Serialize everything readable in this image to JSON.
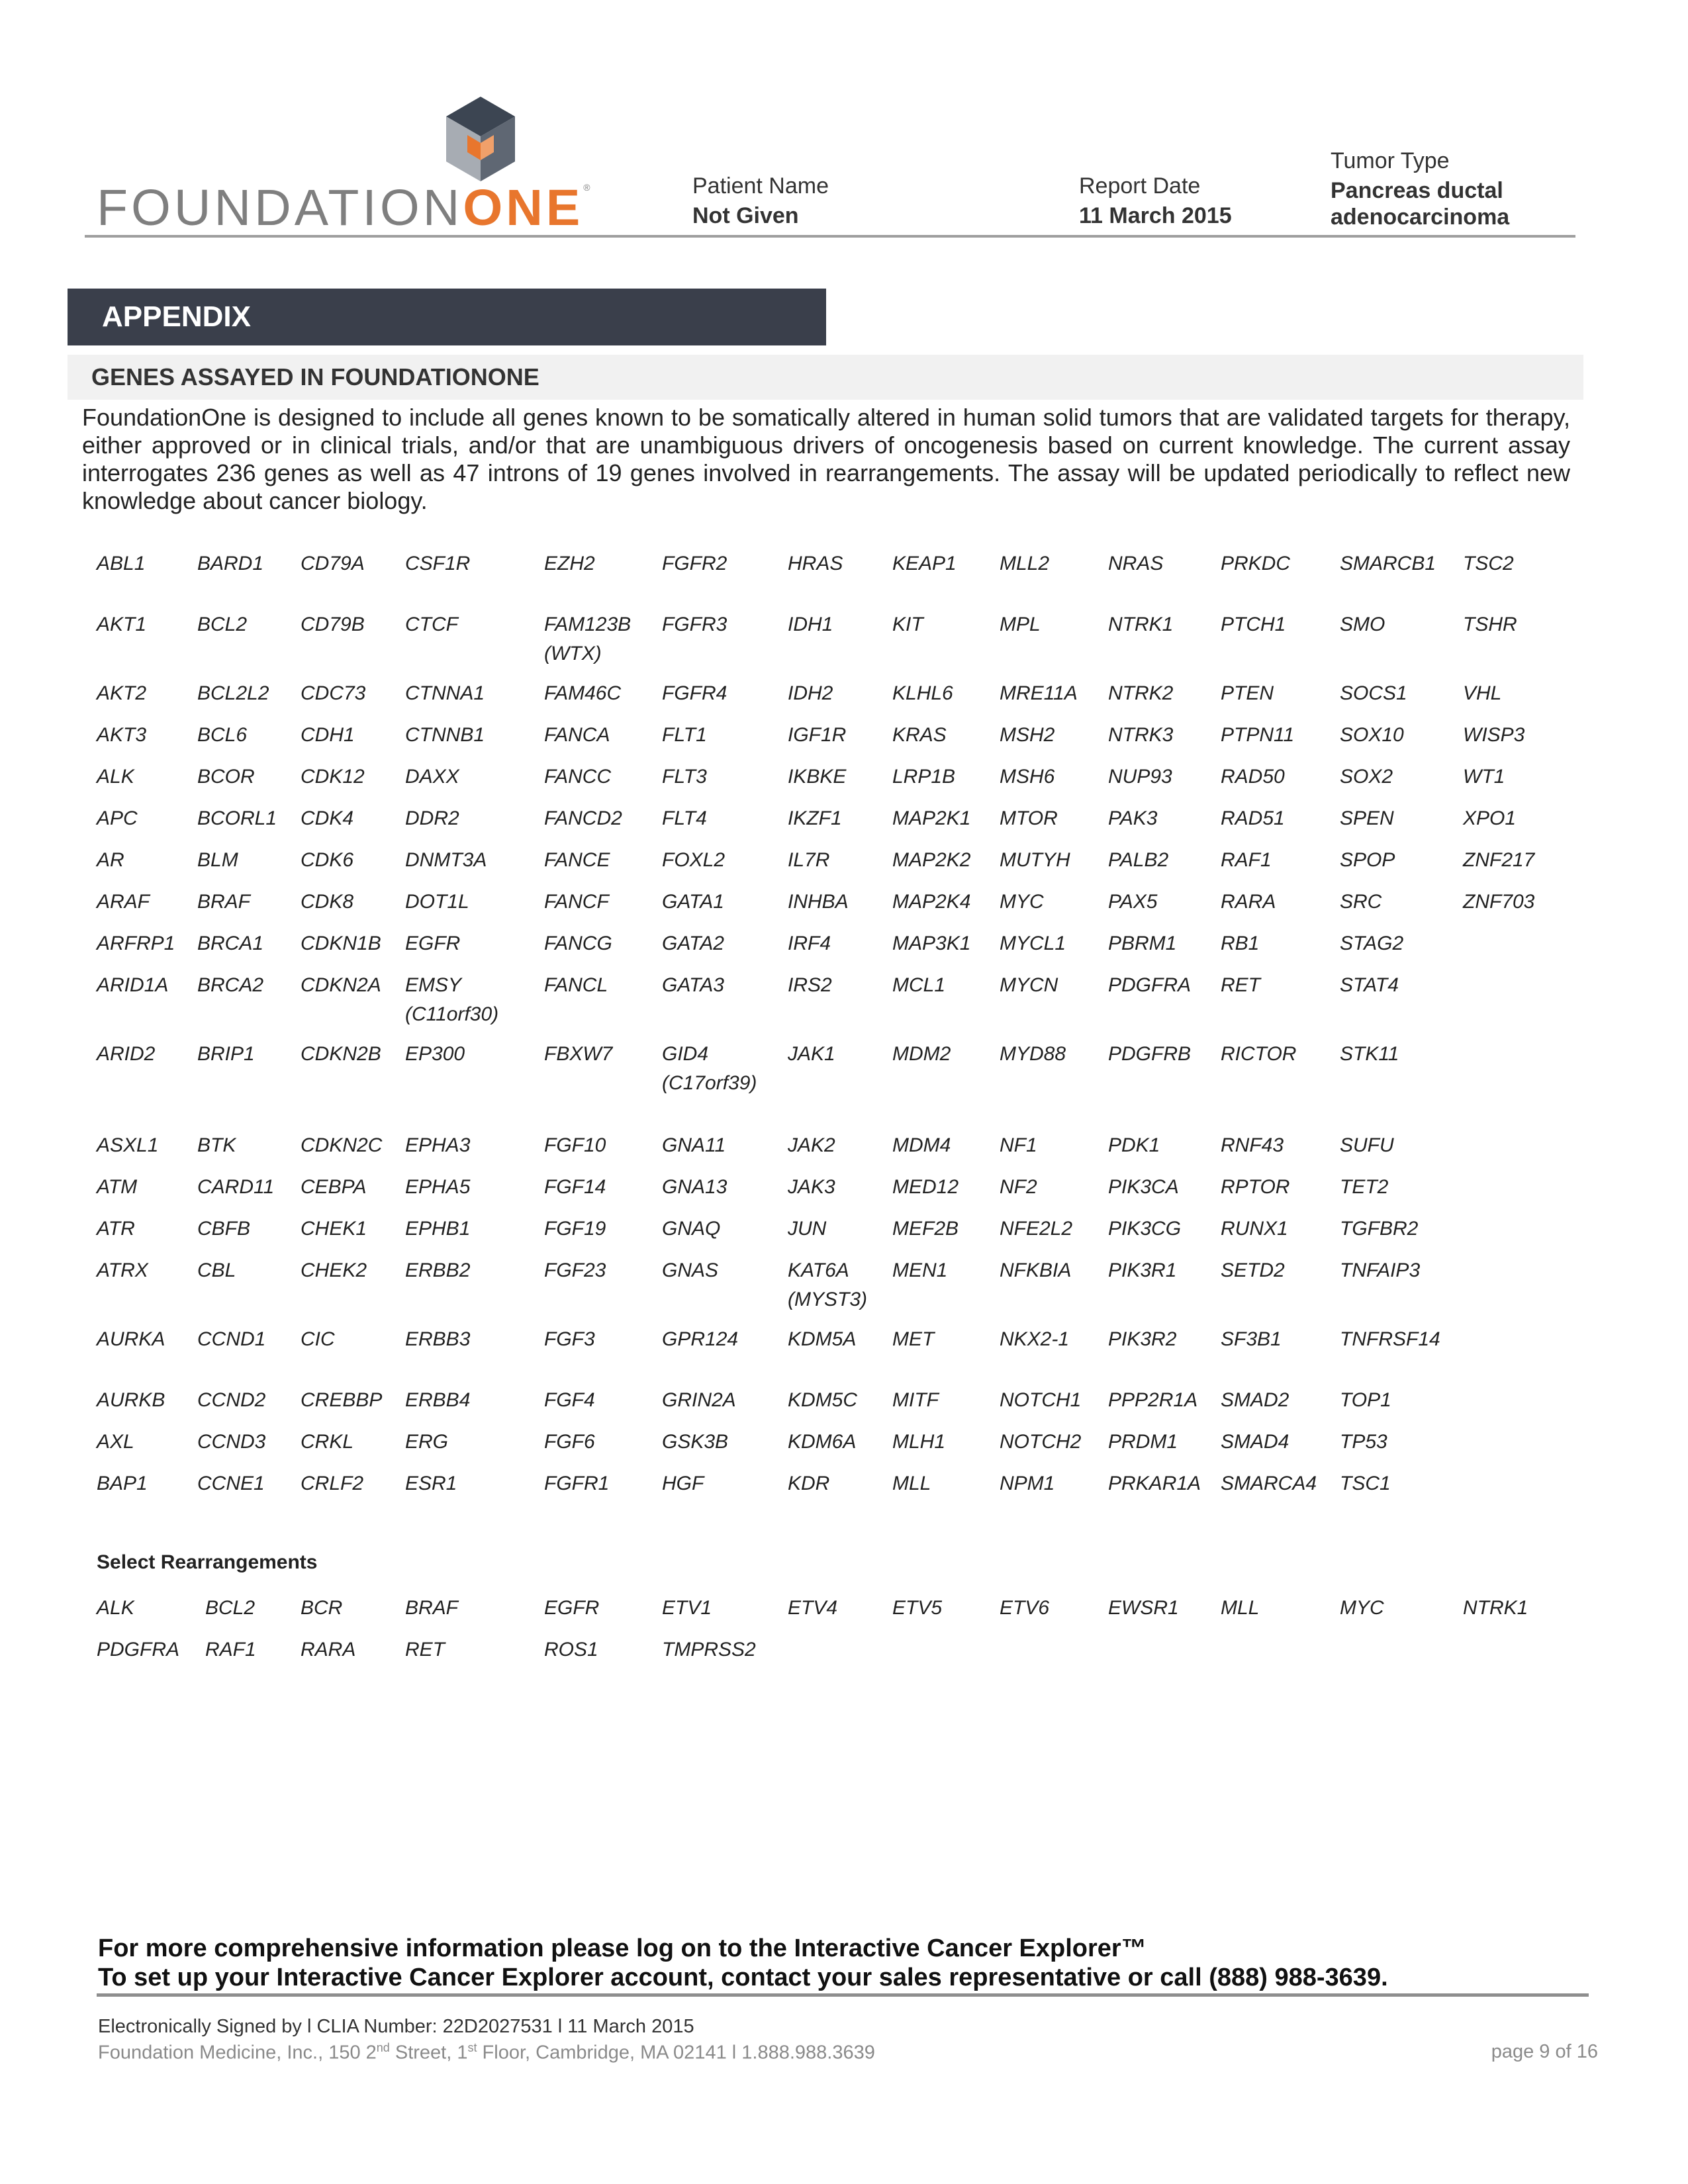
{
  "header": {
    "logo_text_light": "FOUNDATION",
    "logo_text_bold": "ONE",
    "logo_mark": "®",
    "patient_name_label": "Patient Name",
    "patient_name_value": "Not Given",
    "report_date_label": "Report Date",
    "report_date_value": "11 March 2015",
    "tumor_type_label": "Tumor Type",
    "tumor_type_value_line1": "Pancreas ductal",
    "tumor_type_value_line2": "adenocarcinoma"
  },
  "appendix": {
    "title": "APPENDIX",
    "section_title": "GENES ASSAYED IN FOUNDATIONONE",
    "intro": "FoundationOne is designed to include all genes known to be somatically altered in human solid tumors that are validated targets for therapy, either approved or in clinical trials, and/or that are unambiguous drivers of oncogenesis based on current knowledge. The current assay interrogates 236 genes as well as 47 introns of 19 genes involved in rearrangements. The assay will be updated periodically to reflect new knowledge about cancer biology."
  },
  "genes": [
    [
      "ABL1",
      "BARD1",
      "CD79A",
      "CSF1R",
      "EZH2",
      "FGFR2",
      "HRAS",
      "KEAP1",
      "MLL2",
      "NRAS",
      "PRKDC",
      "SMARCB1",
      "TSC2"
    ],
    [
      "AKT1",
      "BCL2",
      "CD79B",
      "CTCF",
      "FAM123B\n(WTX)",
      "FGFR3",
      "IDH1",
      "KIT",
      "MPL",
      "NTRK1",
      "PTCH1",
      "SMO",
      "TSHR"
    ],
    [
      "AKT2",
      "BCL2L2",
      "CDC73",
      "CTNNA1",
      "FAM46C",
      "FGFR4",
      "IDH2",
      "KLHL6",
      "MRE11A",
      "NTRK2",
      "PTEN",
      "SOCS1",
      "VHL"
    ],
    [
      "AKT3",
      "BCL6",
      "CDH1",
      "CTNNB1",
      "FANCA",
      "FLT1",
      "IGF1R",
      "KRAS",
      "MSH2",
      "NTRK3",
      "PTPN11",
      "SOX10",
      "WISP3"
    ],
    [
      "ALK",
      "BCOR",
      "CDK12",
      "DAXX",
      "FANCC",
      "FLT3",
      "IKBKE",
      "LRP1B",
      "MSH6",
      "NUP93",
      "RAD50",
      "SOX2",
      "WT1"
    ],
    [
      "APC",
      "BCORL1",
      "CDK4",
      "DDR2",
      "FANCD2",
      "FLT4",
      "IKZF1",
      "MAP2K1",
      "MTOR",
      "PAK3",
      "RAD51",
      "SPEN",
      "XPO1"
    ],
    [
      "AR",
      "BLM",
      "CDK6",
      "DNMT3A",
      "FANCE",
      "FOXL2",
      "IL7R",
      "MAP2K2",
      "MUTYH",
      "PALB2",
      "RAF1",
      "SPOP",
      "ZNF217"
    ],
    [
      "ARAF",
      "BRAF",
      "CDK8",
      "DOT1L",
      "FANCF",
      "GATA1",
      "INHBA",
      "MAP2K4",
      "MYC",
      "PAX5",
      "RARA",
      "SRC",
      "ZNF703"
    ],
    [
      "ARFRP1",
      "BRCA1",
      "CDKN1B",
      "EGFR",
      "FANCG",
      "GATA2",
      "IRF4",
      "MAP3K1",
      "MYCL1",
      "PBRM1",
      "RB1",
      "STAG2",
      ""
    ],
    [
      "ARID1A",
      "BRCA2",
      "CDKN2A",
      "EMSY\n(C11orf30)",
      "FANCL",
      "GATA3",
      "IRS2",
      "MCL1",
      "MYCN",
      "PDGFRA",
      "RET",
      "STAT4",
      ""
    ],
    [
      "ARID2",
      "BRIP1",
      "CDKN2B",
      "EP300",
      "FBXW7",
      "GID4\n(C17orf39)",
      "JAK1",
      "MDM2",
      "MYD88",
      "PDGFRB",
      "RICTOR",
      "STK11",
      ""
    ],
    [
      "ASXL1",
      "BTK",
      "CDKN2C",
      "EPHA3",
      "FGF10",
      "GNA11",
      "JAK2",
      "MDM4",
      "NF1",
      "PDK1",
      "RNF43",
      "SUFU",
      ""
    ],
    [
      "ATM",
      "CARD11",
      "CEBPA",
      "EPHA5",
      "FGF14",
      "GNA13",
      "JAK3",
      "MED12",
      "NF2",
      "PIK3CA",
      "RPTOR",
      "TET2",
      ""
    ],
    [
      "ATR",
      "CBFB",
      "CHEK1",
      "EPHB1",
      "FGF19",
      "GNAQ",
      "JUN",
      "MEF2B",
      "NFE2L2",
      "PIK3CG",
      "RUNX1",
      "TGFBR2",
      ""
    ],
    [
      "ATRX",
      "CBL",
      "CHEK2",
      "ERBB2",
      "FGF23",
      "GNAS",
      "KAT6A\n(MYST3)",
      "MEN1",
      "NFKBIA",
      "PIK3R1",
      "SETD2",
      "TNFAIP3",
      ""
    ],
    [
      "AURKA",
      "CCND1",
      "CIC",
      "ERBB3",
      "FGF3",
      "GPR124",
      "KDM5A",
      "MET",
      "NKX2-1",
      "PIK3R2",
      "SF3B1",
      "TNFRSF14",
      ""
    ],
    [
      "AURKB",
      "CCND2",
      "CREBBP",
      "ERBB4",
      "FGF4",
      "GRIN2A",
      "KDM5C",
      "MITF",
      "NOTCH1",
      "PPP2R1A",
      "SMAD2",
      "TOP1",
      ""
    ],
    [
      "AXL",
      "CCND3",
      "CRKL",
      "ERG",
      "FGF6",
      "GSK3B",
      "KDM6A",
      "MLH1",
      "NOTCH2",
      "PRDM1",
      "SMAD4",
      "TP53",
      ""
    ],
    [
      "BAP1",
      "CCNE1",
      "CRLF2",
      "ESR1",
      "FGFR1",
      "HGF",
      "KDR",
      "MLL",
      "NPM1",
      "PRKAR1A",
      "SMARCA4",
      "TSC1",
      ""
    ]
  ],
  "rearrangements": {
    "title": "Select Rearrangements",
    "rows": [
      [
        "ALK",
        "BCL2",
        "BCR",
        "BRAF",
        "EGFR",
        "ETV1",
        "ETV4",
        "ETV5",
        "ETV6",
        "EWSR1",
        "MLL",
        "MYC",
        "NTRK1"
      ],
      [
        "PDGFRA",
        "RAF1",
        "RARA",
        "RET",
        "ROS1",
        "TMPRSS2",
        "",
        "",
        "",
        "",
        "",
        "",
        ""
      ]
    ]
  },
  "footer": {
    "line1": "For more comprehensive information please log on to the Interactive Cancer Explorer™",
    "line2": "To set up your Interactive Cancer Explorer account, contact your sales representative or call  (888) 988-3639.",
    "signed": "Electronically Signed by  l CLIA Number: 22D2027531 l 11 March 2015",
    "address_a": "Foundation Medicine, Inc., 150 2",
    "address_sup1": "nd",
    "address_b": " Street, 1",
    "address_sup2": "st",
    "address_c": " Floor, Cambridge, MA 02141 l 1.888.988.3639",
    "page": "page 9 of 16"
  },
  "colors": {
    "brand_orange": "#e8762d",
    "brand_gray": "#7f7f7f",
    "band_dark": "#3a3f4b"
  }
}
